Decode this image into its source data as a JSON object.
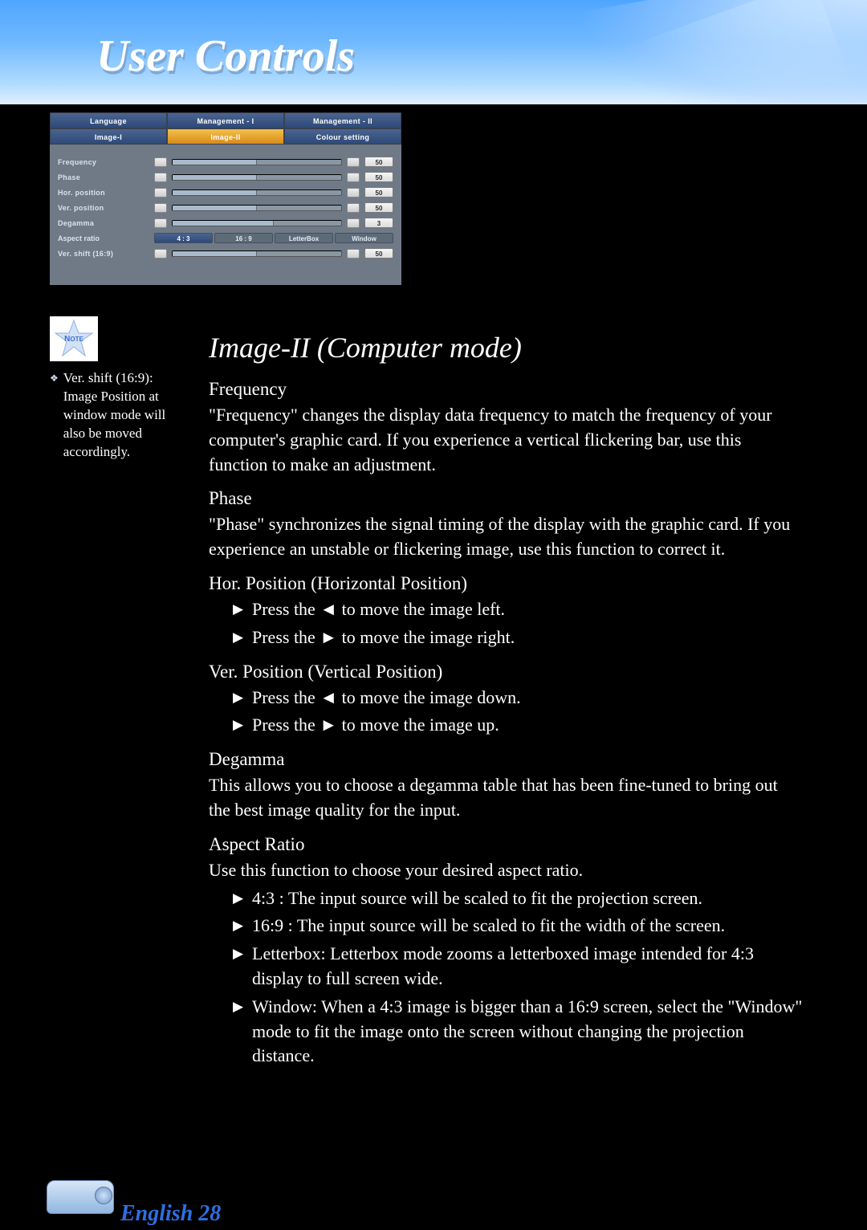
{
  "header": {
    "title": "User Controls"
  },
  "menu": {
    "tabs_row1": [
      {
        "label": "Language"
      },
      {
        "label": "Management - I"
      },
      {
        "label": "Management - II"
      }
    ],
    "tabs_row2": [
      {
        "label": "Image-I"
      },
      {
        "label": "Image-II",
        "active": true
      },
      {
        "label": "Colour setting"
      }
    ],
    "rows": {
      "frequency": {
        "label": "Frequency",
        "value": "50",
        "pct": 50
      },
      "phase": {
        "label": "Phase",
        "value": "50",
        "pct": 50
      },
      "hpos": {
        "label": "Hor. position",
        "value": "50",
        "pct": 50
      },
      "vpos": {
        "label": "Ver. position",
        "value": "50",
        "pct": 50
      },
      "degamma": {
        "label": "Degamma",
        "value": "3",
        "pct": 60
      },
      "aspect": {
        "label": "Aspect ratio"
      },
      "vshift": {
        "label": "Ver. shift (16:9)",
        "value": "50",
        "pct": 50
      }
    },
    "aspect_options": [
      {
        "label": "4 : 3",
        "selected": true
      },
      {
        "label": "16 : 9",
        "selected": false
      },
      {
        "label": "LetterBox",
        "selected": false
      },
      {
        "label": "Window",
        "selected": false
      }
    ]
  },
  "note_icon_label": "NOTE",
  "side_note": "Ver. shift (16:9): Image Position at window mode will also be moved accordingly.",
  "section_title": "Image-II (Computer mode)",
  "frequency": {
    "h": "Frequency",
    "p": "\"Frequency\" changes the display data frequency to match the frequency of your computer's graphic card. If you experience a vertical flickering bar, use this function to make an adjustment."
  },
  "phase": {
    "h": "Phase",
    "p": "\"Phase\" synchronizes the signal timing of the display with the graphic card. If you experience an unstable or flickering image, use this function to correct it."
  },
  "hpos": {
    "h": "Hor. Position (Horizontal Position)",
    "b1": "Press the ◄ to move the image left.",
    "b2": "Press the ► to move the image right."
  },
  "vpos": {
    "h": "Ver. Position (Vertical Position)",
    "b1": "Press the ◄ to move the image down.",
    "b2": "Press the ► to move the image up."
  },
  "degamma": {
    "h": "Degamma",
    "p": "This allows you to choose a degamma table that has been fine-tuned to bring out the best image quality for the input."
  },
  "aspect": {
    "h": "Aspect Ratio",
    "p": "Use this function to choose your desired aspect ratio.",
    "b1": "4:3 : The input source will be scaled to fit the projection screen.",
    "b2": "16:9 : The input source will be scaled to fit the width of the screen.",
    "b3": "Letterbox: Letterbox mode zooms a letterboxed image intended for 4:3 display to full screen wide.",
    "b4": "Window: When a 4:3 image is bigger than a 16:9 screen, select the \"Window\" mode to fit the image onto the screen without changing the projection distance."
  },
  "footer": {
    "language": "English",
    "page": "28"
  }
}
